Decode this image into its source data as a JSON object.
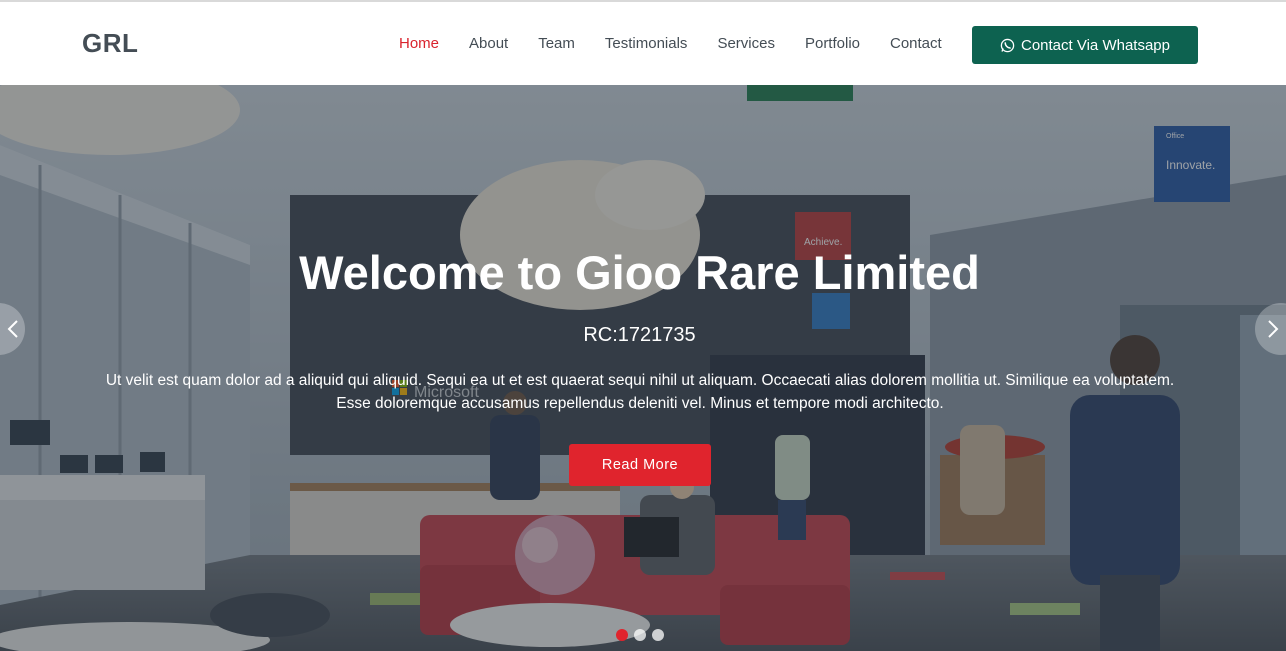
{
  "header": {
    "logo": "GRL",
    "nav": [
      {
        "label": "Home",
        "active": true
      },
      {
        "label": "About"
      },
      {
        "label": "Team"
      },
      {
        "label": "Testimonials"
      },
      {
        "label": "Services"
      },
      {
        "label": "Portfolio"
      },
      {
        "label": "Contact"
      }
    ],
    "whatsapp_label": "Contact Via Whatsapp",
    "whatsapp_icon": "whatsapp-icon"
  },
  "hero": {
    "title": "Welcome to Gioo Rare Limited",
    "rc": "RC:1721735",
    "text_line1": "Ut velit est quam dolor ad a aliquid qui aliquid. Sequi ea ut et est quaerat sequi nihil ut aliquam. Occaecati alias dolorem mollitia ut. Similique ea voluptatem.",
    "text_line2": "Esse doloremque accusamus repellendus deleniti vel. Minus et tempore modi architecto.",
    "button_label": "Read More",
    "slide_count": 3,
    "active_slide": 1,
    "background_image_signs": {
      "brand": "Microsoft",
      "sign_top_right": "Innovate.",
      "sign_middle": "Achieve.",
      "sign_office": "Office"
    }
  },
  "colors": {
    "accent": "#d9232d",
    "button_red": "#e0242d",
    "whatsapp_green": "#0d6250",
    "nav_text": "#444d55"
  }
}
